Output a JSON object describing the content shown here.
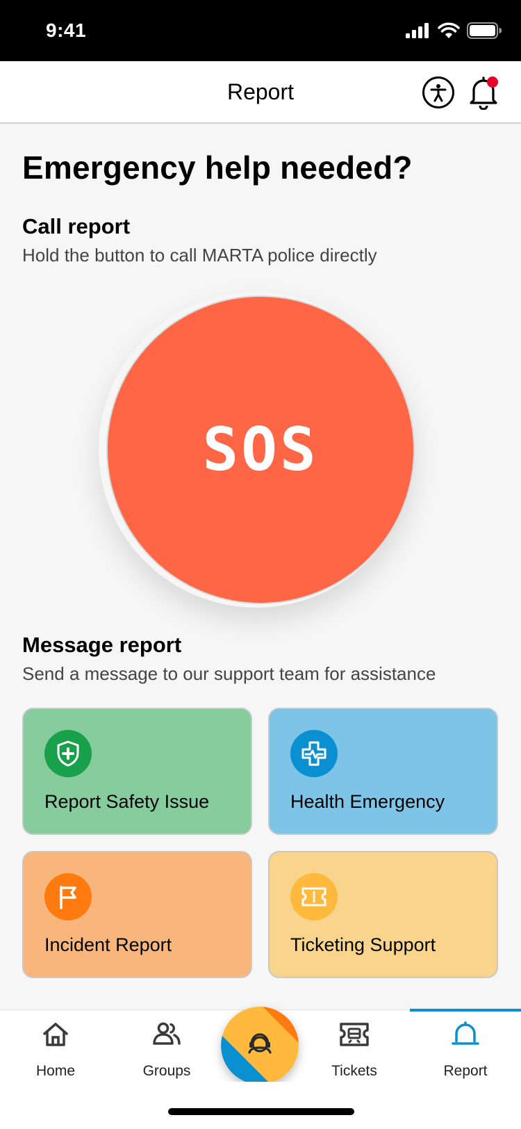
{
  "status_bar": {
    "time": "9:41"
  },
  "header": {
    "title": "Report"
  },
  "page": {
    "title": "Emergency help needed?"
  },
  "call_report": {
    "title": "Call report",
    "subtitle": "Hold the button to call MARTA police directly",
    "button_label": "SOS",
    "button_color": "#ff6645"
  },
  "message_report": {
    "title": "Message report",
    "subtitle": "Send a message to our support team for assistance",
    "cards": [
      {
        "label": "Report Safety Issue",
        "icon": "shield-plus-icon",
        "bg": "#86cc9c",
        "icon_bg": "#18a04a"
      },
      {
        "label": "Health Emergency",
        "icon": "heartbeat-cross-icon",
        "bg": "#7ec4e6",
        "icon_bg": "#0a8fd1"
      },
      {
        "label": "Incident Report",
        "icon": "flag-icon",
        "bg": "#f8b67c",
        "icon_bg": "#ff7a0f"
      },
      {
        "label": "Ticketing Support",
        "icon": "ticket-icon",
        "bg": "#f8d48c",
        "icon_bg": "#ffb93c"
      }
    ]
  },
  "tabbar": {
    "items": [
      {
        "label": "Home",
        "icon": "home-icon"
      },
      {
        "label": "Groups",
        "icon": "groups-icon"
      },
      {
        "label": "Tickets",
        "icon": "tickets-icon"
      },
      {
        "label": "Report",
        "icon": "report-siren-icon",
        "active": true
      }
    ],
    "center_button_icon": "support-agent-icon",
    "active_color": "#0a8fd1"
  }
}
